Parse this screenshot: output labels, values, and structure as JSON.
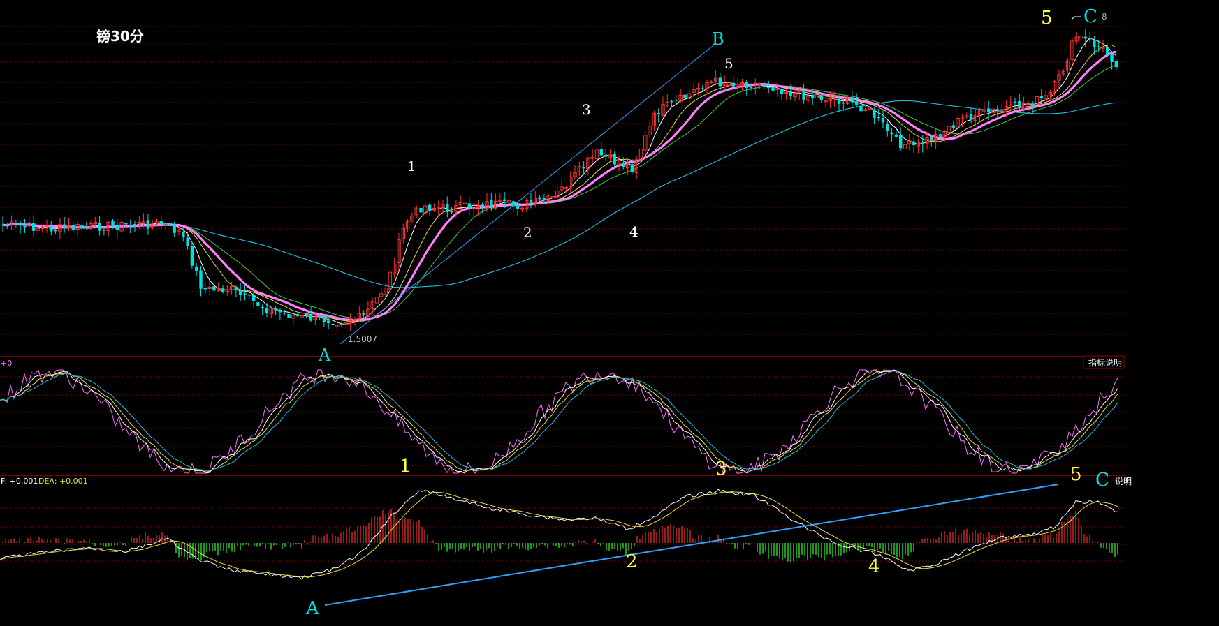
{
  "chart_data": {
    "type": "candlestick",
    "title": "镑30分",
    "price_label": "1.5007",
    "indicator_btn": "指标说明",
    "indicator_btn_short": "说明",
    "kdj_label": "+0",
    "macd_label": "F: +0.001",
    "dea_label": "DEA: +0.001",
    "price_wave_labels": [
      {
        "text": "A",
        "color": "cyan"
      },
      {
        "text": "1",
        "color": "white"
      },
      {
        "text": "2",
        "color": "white"
      },
      {
        "text": "3",
        "color": "white"
      },
      {
        "text": "4",
        "color": "white"
      },
      {
        "text": "5",
        "color": "white"
      },
      {
        "text": "B",
        "color": "cyan"
      },
      {
        "text": "5",
        "color": "yellow"
      },
      {
        "text": "C",
        "color": "cyan"
      },
      {
        "text": "8",
        "color": "gray"
      }
    ],
    "macd_wave_labels": [
      {
        "text": "1",
        "color": "yellow"
      },
      {
        "text": "3",
        "color": "yellow"
      },
      {
        "text": "5",
        "color": "yellow"
      },
      {
        "text": "C",
        "color": "cyan"
      },
      {
        "text": "2",
        "color": "yellow"
      },
      {
        "text": "4",
        "color": "yellow"
      },
      {
        "text": "A",
        "color": "cyan"
      }
    ],
    "colors": {
      "up": "#ff3030",
      "down": "#00e0e0",
      "ma5": "#ffffff",
      "ma10": "#e0e040",
      "ma20": "#40d040",
      "ma30": "#ff80ff",
      "ma60": "#20c0e0",
      "trend": "#30a0ff",
      "k": "#ffffff",
      "d": "#e0e040",
      "j": "#ff70ff",
      "grid": "#7a0000"
    }
  }
}
